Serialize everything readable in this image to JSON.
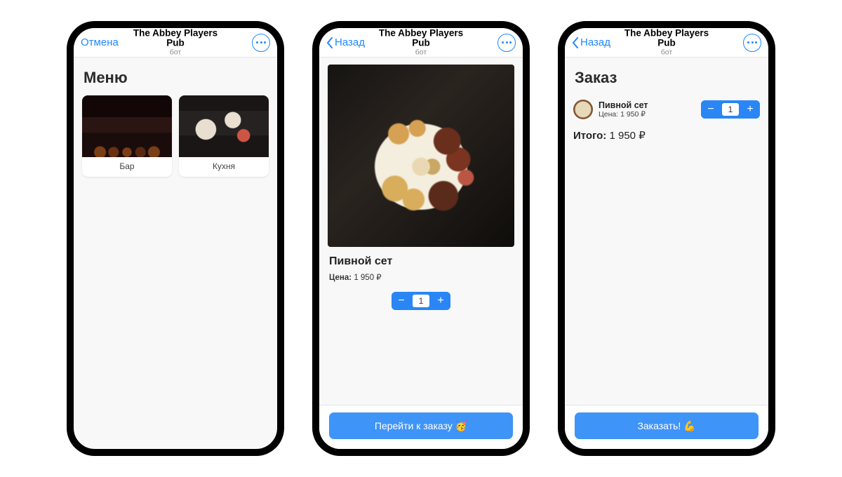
{
  "header": {
    "title": "The Abbey Players Pub",
    "subtitle": "бот",
    "cancel": "Отмена",
    "back": "Назад"
  },
  "screen1": {
    "page_title": "Меню",
    "cards": [
      {
        "label": "Бар"
      },
      {
        "label": "Кухня"
      }
    ]
  },
  "screen2": {
    "product_title": "Пивной сет",
    "price_label": "Цена:",
    "price_value": "1 950 ₽",
    "qty": "1",
    "cta": "Перейти к заказу 🥳"
  },
  "screen3": {
    "page_title": "Заказ",
    "item": {
      "name": "Пивной сет",
      "price_label": "Цена:",
      "price_value": "1 950 ₽",
      "qty": "1"
    },
    "total_label": "Итого:",
    "total_value": "1 950 ₽",
    "cta": "Заказать! 💪"
  }
}
